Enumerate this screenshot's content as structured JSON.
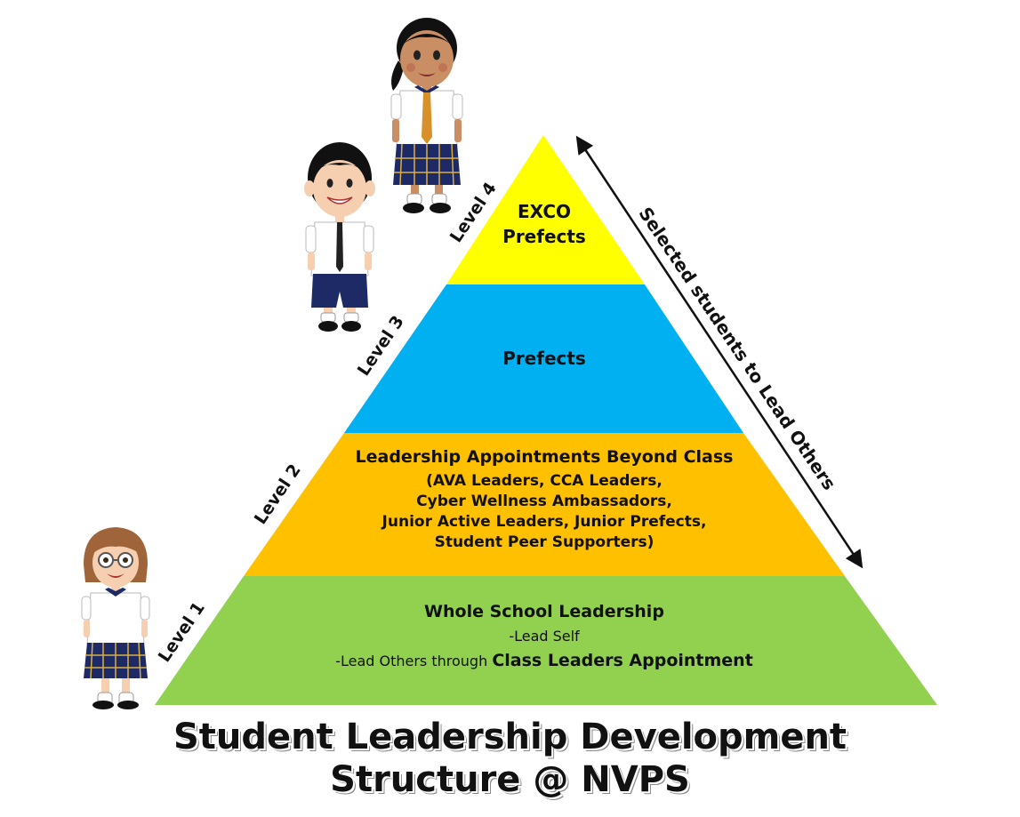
{
  "colors": {
    "tier4": "#ffff00",
    "tier3": "#00b0f0",
    "tier2": "#ffc000",
    "tier1": "#92d050"
  },
  "levels": {
    "l1": "Level 1",
    "l2": "Level 2",
    "l3": "Level 3",
    "l4": "Level 4"
  },
  "tier4": {
    "line1": "EXCO",
    "line2": "Prefects"
  },
  "tier3": {
    "line1": "Prefects"
  },
  "tier2": {
    "line1": "Leadership Appointments Beyond Class",
    "line2": "(AVA Leaders, CCA Leaders,",
    "line3": "Cyber Wellness Ambassadors,",
    "line4": "Junior Active Leaders, Junior Prefects,",
    "line5": "Student Peer Supporters)"
  },
  "tier1": {
    "line1": "Whole School Leadership",
    "line2": "-Lead Self",
    "line3a": "-Lead Others through ",
    "line3b": "Class Leaders Appointment"
  },
  "arrow_label": "Selected students to Lead Others",
  "title": {
    "line1": "Student Leadership Development",
    "line2": "Structure @ NVPS"
  },
  "figures": [
    "student-girl-glasses-icon",
    "student-boy-icon",
    "student-girl-icon"
  ]
}
